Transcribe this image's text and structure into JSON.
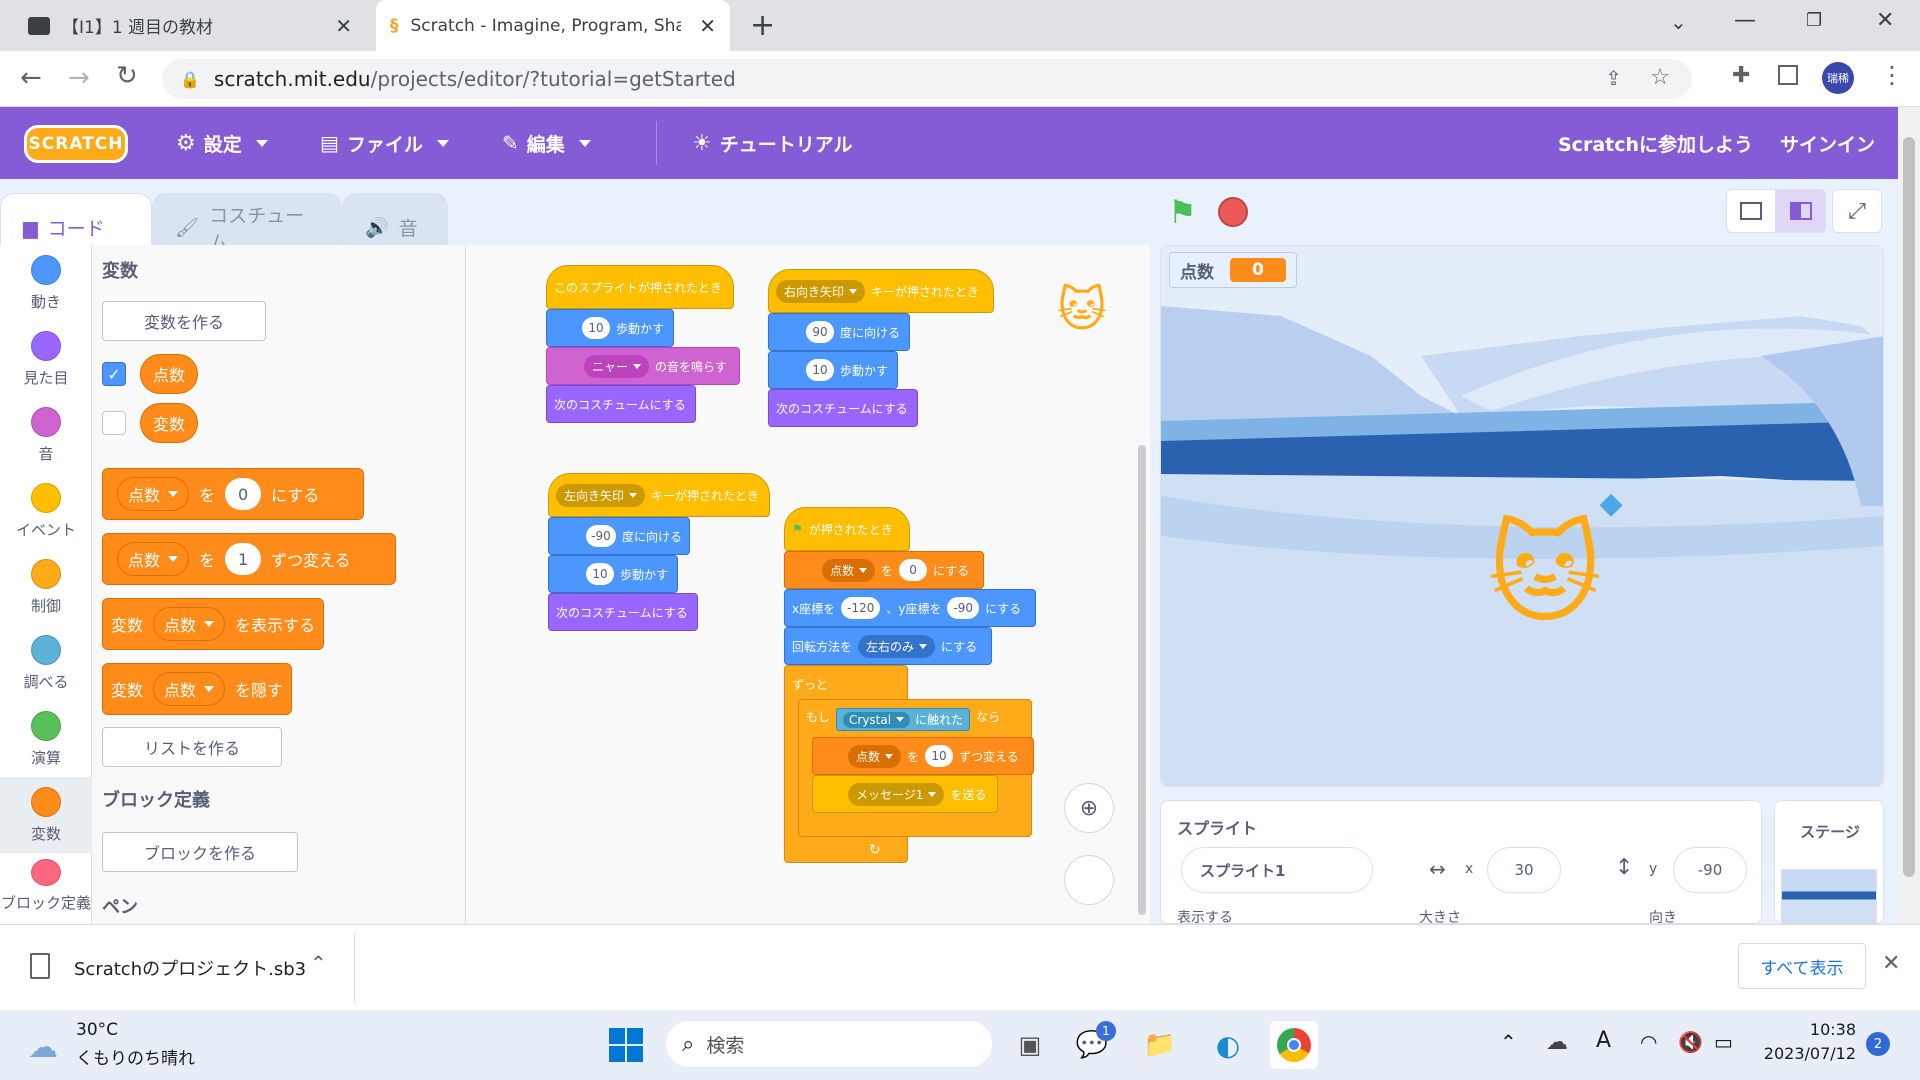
{
  "browser": {
    "tabs": [
      {
        "title": "【I1】1 週目の教材",
        "icon": "classroom-icon"
      },
      {
        "title": "Scratch - Imagine, Program, Shar",
        "icon": "scratch-favicon-icon"
      }
    ],
    "url_host": "scratch.mit.edu",
    "url_path": "/projects/editor/?tutorial=getStarted",
    "profile_label": "瑞稀"
  },
  "menubar": {
    "logo": "SCRATCH",
    "settings": "設定",
    "file": "ファイル",
    "edit": "編集",
    "tutorial": "チュートリアル",
    "join": "Scratchに参加しよう",
    "signin": "サインイン",
    "brand_color": "#855cd6"
  },
  "editor_tabs": {
    "code": "コード",
    "costume": "コスチューム",
    "sound": "音"
  },
  "categories": [
    {
      "label": "動き",
      "color": "#4c97ff"
    },
    {
      "label": "見た目",
      "color": "#9966ff"
    },
    {
      "label": "音",
      "color": "#cf63cf"
    },
    {
      "label": "イベント",
      "color": "#ffbf00"
    },
    {
      "label": "制御",
      "color": "#ffab19"
    },
    {
      "label": "調べる",
      "color": "#5cb1d6"
    },
    {
      "label": "演算",
      "color": "#59c059"
    },
    {
      "label": "変数",
      "color": "#ff8c1a"
    },
    {
      "label": "ブロック定義",
      "color": "#ff6680"
    }
  ],
  "palette": {
    "variables_title": "変数",
    "make_variable": "変数を作る",
    "var1": "点数",
    "var2": "変数",
    "set_to": "を",
    "set_value": "0",
    "set_suffix": "にする",
    "change_value": "1",
    "change_suffix": "ずつ変える",
    "show_prefix": "変数",
    "show_suffix": "を表示する",
    "hide_suffix": "を隠す",
    "make_list": "リストを作る",
    "myblocks_title": "ブロック定義",
    "make_block": "ブロックを作る",
    "pen_title": "ペン"
  },
  "scripts": {
    "s1_hat": "このスプライトが押されたとき",
    "s1_move_n": "10",
    "s1_move": "歩動かす",
    "s1_sound": "ニャー",
    "s1_sound_suffix": "の音を鳴らす",
    "s1_costume": "次のコスチュームにする",
    "s2_key": "右向き矢印",
    "s2_hat_suffix": "キーが押されたとき",
    "s2_dir": "90",
    "s2_dir_suffix": "度に向ける",
    "s2_move_n": "10",
    "s2_move": "歩動かす",
    "s2_costume": "次のコスチュームにする",
    "s3_key": "左向き矢印",
    "s3_hat_suffix": "キーが押されたとき",
    "s3_dir": "-90",
    "s3_dir_suffix": "度に向ける",
    "s3_move_n": "10",
    "s3_move": "歩動かす",
    "s3_costume": "次のコスチュームにする",
    "s4_hat": "が押されたとき",
    "s4_var": "点数",
    "s4_set_mid": "を",
    "s4_set_val": "0",
    "s4_set_suffix": "にする",
    "s4_goto_x_label": "x座標を",
    "s4_goto_x": "-120",
    "s4_goto_y_label": "、y座標を",
    "s4_goto_y": "-90",
    "s4_goto_suffix": "にする",
    "s4_rot_label": "回転方法を",
    "s4_rot": "左右のみ",
    "s4_rot_suffix": "にする",
    "s4_forever": "ずっと",
    "s4_if": "もし",
    "s4_touch": "Crystal",
    "s4_touch_suffix": "に触れた",
    "s4_then": "なら",
    "s4_change_var": "点数",
    "s4_change_mid": "を",
    "s4_change_val": "10",
    "s4_change_suffix": "ずつ変える",
    "s4_broadcast": "メッセージ1",
    "s4_broadcast_suffix": "を送る"
  },
  "stage": {
    "monitor_label": "点数",
    "monitor_value": "0"
  },
  "sprite_info": {
    "title": "スプライト",
    "name": "スプライト1",
    "x_label": "x",
    "x": "30",
    "y_label": "y",
    "y": "-90",
    "show_label": "表示する",
    "size_label": "大きさ",
    "direction_label": "向き",
    "stage_label": "ステージ"
  },
  "download_bar": {
    "file": "Scratchのプロジェクト.sb3",
    "show_all": "すべて表示"
  },
  "taskbar": {
    "temp": "30°C",
    "weather": "くもりのち晴れ",
    "search": "検索",
    "teams_badge": "1",
    "ime": "A",
    "time": "10:38",
    "date": "2023/07/12",
    "notif": "2"
  }
}
